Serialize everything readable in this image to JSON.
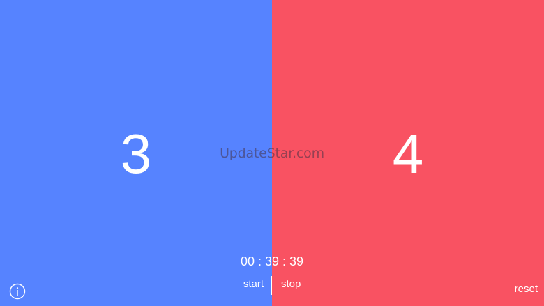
{
  "left_team": {
    "score": "3",
    "color": "#5683FF"
  },
  "right_team": {
    "score": "4",
    "color": "#F95262"
  },
  "watermark": "UpdateStar.com",
  "timer": {
    "display": "00 : 39 : 39"
  },
  "controls": {
    "start_label": "start",
    "stop_label": "stop",
    "reset_label": "reset",
    "info_icon": "info-icon"
  }
}
